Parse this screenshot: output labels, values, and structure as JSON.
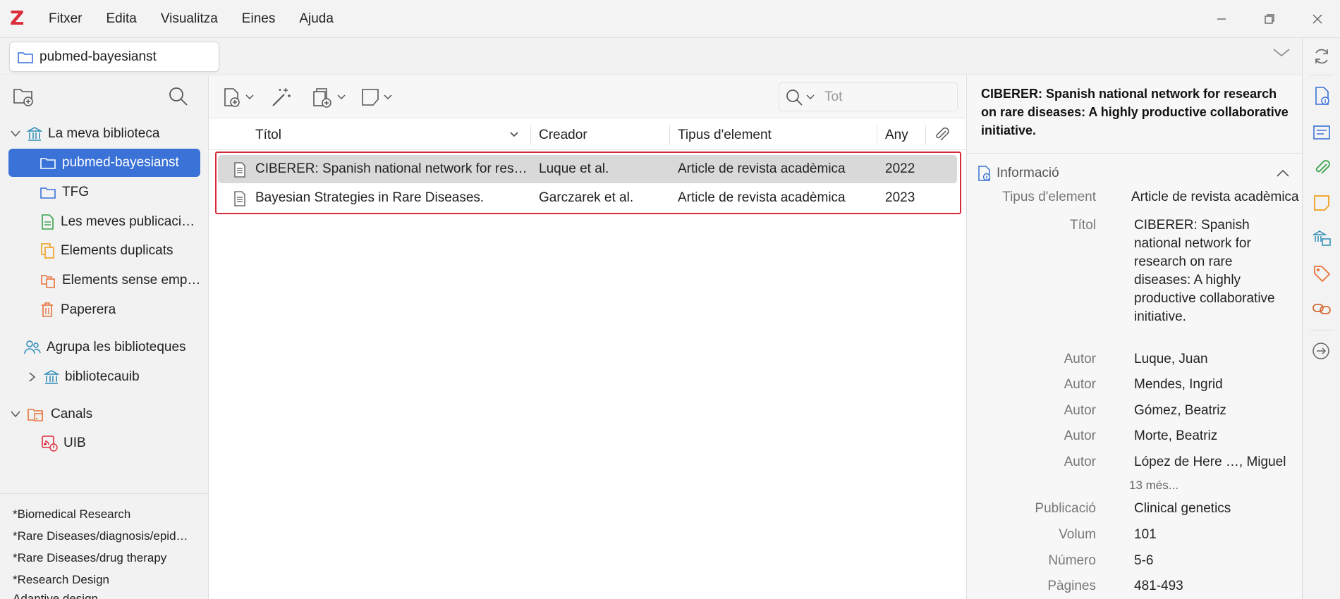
{
  "app": {
    "logo": "Z"
  },
  "menu": [
    "Fitxer",
    "Edita",
    "Visualitza",
    "Eines",
    "Ajuda"
  ],
  "tab": {
    "label": "pubmed-bayesianst"
  },
  "collections": {
    "items": [
      {
        "label": "La meva biblioteca",
        "icon": "library-icon"
      },
      {
        "label": "pubmed-bayesianst",
        "icon": "folder-icon"
      },
      {
        "label": "TFG",
        "icon": "folder-icon"
      },
      {
        "label": "Les meves publicaci…",
        "icon": "publications-icon"
      },
      {
        "label": "Elements duplicats",
        "icon": "duplicates-icon"
      },
      {
        "label": "Elements sense emp…",
        "icon": "unfiled-icon"
      },
      {
        "label": "Paperera",
        "icon": "trash-icon"
      },
      {
        "label": "Agrupa les biblioteques",
        "icon": "groups-icon"
      },
      {
        "label": "bibliotecauib",
        "icon": "library-icon"
      },
      {
        "label": "Canals",
        "icon": "feeds-icon"
      },
      {
        "label": "UIB",
        "icon": "feed-icon"
      }
    ],
    "tags": [
      "*Biomedical Research",
      "*Rare Diseases/diagnosis/epid…",
      "*Rare Diseases/drug therapy",
      "*Research Design",
      "Adaptive design..."
    ]
  },
  "items_pane": {
    "search_placeholder": "Tot",
    "columns": {
      "title": "Títol",
      "creator": "Creador",
      "type": "Tipus d'element",
      "year": "Any"
    },
    "rows": [
      {
        "title": "CIBERER: Spanish national network for res…",
        "creator": "Luque et al.",
        "type": "Article de revista acadèmica",
        "year": "2022"
      },
      {
        "title": "Bayesian Strategies in Rare Diseases.",
        "creator": "Garczarek et al.",
        "type": "Article de revista acadèmica",
        "year": "2023"
      }
    ]
  },
  "item_pane": {
    "header_title": "CIBERER: Spanish national network for research on rare diseases: A highly productive collaborative initiative.",
    "section": "Informació",
    "fields": {
      "type_label": "Tipus d'element",
      "type_value": "Article de revista acadèmica",
      "title_label": "Títol",
      "title_value": "CIBERER: Spanish national network for research on rare diseases: A highly productive collaborative initiative.",
      "authors": [
        {
          "label": "Autor",
          "value": "Luque, Juan"
        },
        {
          "label": "Autor",
          "value": "Mendes, Ingrid"
        },
        {
          "label": "Autor",
          "value": "Gómez, Beatriz"
        },
        {
          "label": "Autor",
          "value": "Morte, Beatriz"
        },
        {
          "label": "Autor",
          "value": "López de Here  …, Miguel"
        }
      ],
      "more": "13 més...",
      "publication_label": "Publicació",
      "publication_value": "Clinical genetics",
      "volume_label": "Volum",
      "volume_value": "101",
      "issue_label": "Número",
      "issue_value": "5-6",
      "pages_label": "Pàgines",
      "pages_value": "481-493"
    }
  },
  "colors": {
    "accent": "#3a72d8",
    "logo": "#db2c3a",
    "highlight": "#d42a3c",
    "strip_blue": "#3a72d8",
    "strip_green": "#39a14a",
    "strip_orange": "#f0a020"
  }
}
